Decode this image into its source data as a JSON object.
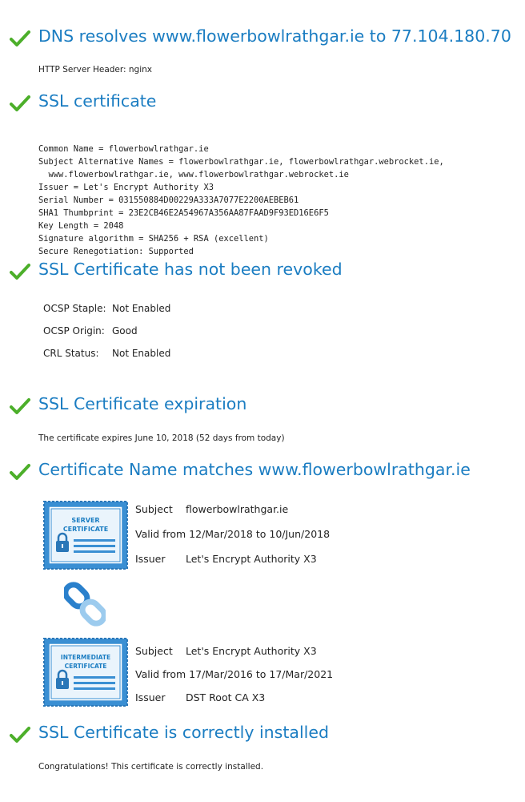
{
  "dns": {
    "heading": "DNS resolves www.flowerbowlrathgar.ie to 77.104.180.70",
    "server_header": "HTTP Server Header: nginx"
  },
  "ssl_cert": {
    "heading": "SSL certificate",
    "lines": [
      "Common Name = flowerbowlrathgar.ie",
      "Subject Alternative Names = flowerbowlrathgar.ie, flowerbowlrathgar.webrocket.ie,",
      "  www.flowerbowlrathgar.ie, www.flowerbowlrathgar.webrocket.ie",
      "Issuer = Let's Encrypt Authority X3",
      "Serial Number = 031550884D00229A333A7077E2200AEBEB61",
      "SHA1 Thumbprint = 23E2CB46E2A54967A356AA87FAAD9F93ED16E6F5",
      "Key Length = 2048",
      "Signature algorithm = SHA256 + RSA (excellent)",
      "Secure Renegotiation: Supported"
    ]
  },
  "revocation": {
    "heading": "SSL Certificate has not been revoked",
    "rows": [
      {
        "label": "OCSP Staple:",
        "value": "Not Enabled"
      },
      {
        "label": "OCSP Origin:",
        "value": "Good"
      },
      {
        "label": "CRL Status:",
        "value": "Not Enabled"
      }
    ]
  },
  "expiration": {
    "heading": "SSL Certificate expiration",
    "text": "The certificate expires June 10, 2018 (52 days from today)"
  },
  "name_match": {
    "heading": "Certificate Name matches www.flowerbowlrathgar.ie",
    "server_cert": {
      "badge_line1": "SERVER",
      "badge_line2": "CERTIFICATE",
      "subject_label": "Subject",
      "subject": "flowerbowlrathgar.ie",
      "valid": "Valid from 12/Mar/2018 to 10/Jun/2018",
      "issuer_label": "Issuer",
      "issuer": "Let's Encrypt Authority X3"
    },
    "intermediate_cert": {
      "badge_line1": "INTERMEDIATE",
      "badge_line2": "CERTIFICATE",
      "subject_label": "Subject",
      "subject": "Let's Encrypt Authority X3",
      "valid": "Valid from 17/Mar/2016 to 17/Mar/2021",
      "issuer_label": "Issuer",
      "issuer": "DST Root CA X3"
    }
  },
  "installed": {
    "heading": "SSL Certificate is correctly installed",
    "text": "Congratulations! This certificate is correctly installed."
  },
  "colors": {
    "heading_blue": "#1b7dc2",
    "check_green": "#4caf2a",
    "badge_blue": "#3a8fd3"
  },
  "icons": {
    "check": "check-icon",
    "cert_badge": "certificate-badge-icon",
    "chain_link": "chain-link-icon"
  }
}
